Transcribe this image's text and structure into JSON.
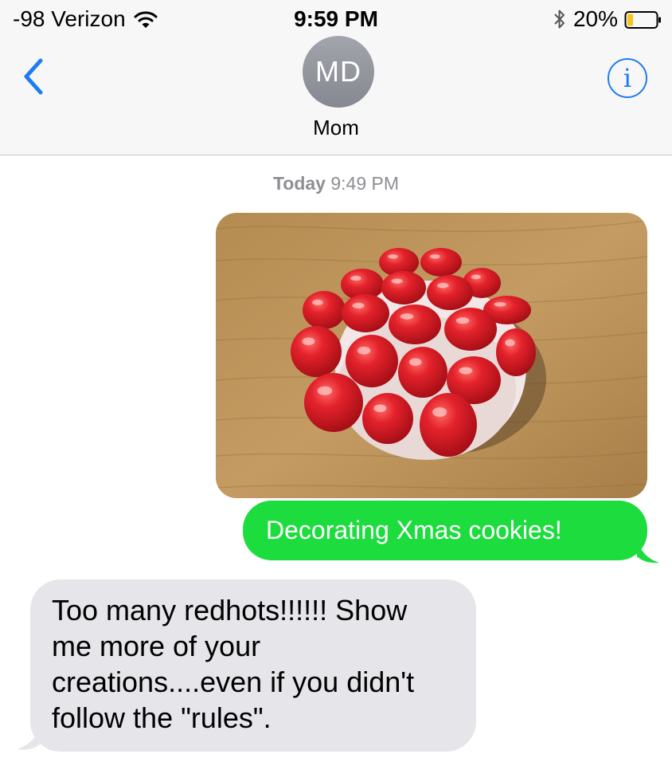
{
  "status_bar": {
    "carrier": "-98 Verizon",
    "time": "9:59 PM",
    "battery_percent": "20%",
    "battery_level": 0.2,
    "icons": [
      "wifi-icon",
      "bluetooth-icon",
      "battery-icon"
    ]
  },
  "nav": {
    "back_icon": "chevron-left-icon",
    "avatar_initials": "MD",
    "contact_name": "Mom",
    "info_icon": "info-icon",
    "info_glyph": "i"
  },
  "thread": {
    "timestamp_day": "Today",
    "timestamp_time": "9:49 PM",
    "photo_subject": "cookie-with-red-candies",
    "outgoing_text": "Decorating Xmas cookies!",
    "incoming_lines": [
      "Too many redhots!!!!!!  Show",
      "me more of your",
      "creations....even if you didn't",
      "follow the \"rules\"."
    ]
  },
  "colors": {
    "accent_blue": "#1e7cf2",
    "outgoing_bubble": "#1ddc3e",
    "incoming_bubble": "#e5e5ea",
    "header_bg": "#f7f7f8",
    "timestamp_gray": "#8e8e93",
    "battery_fill": "#f5c518"
  }
}
